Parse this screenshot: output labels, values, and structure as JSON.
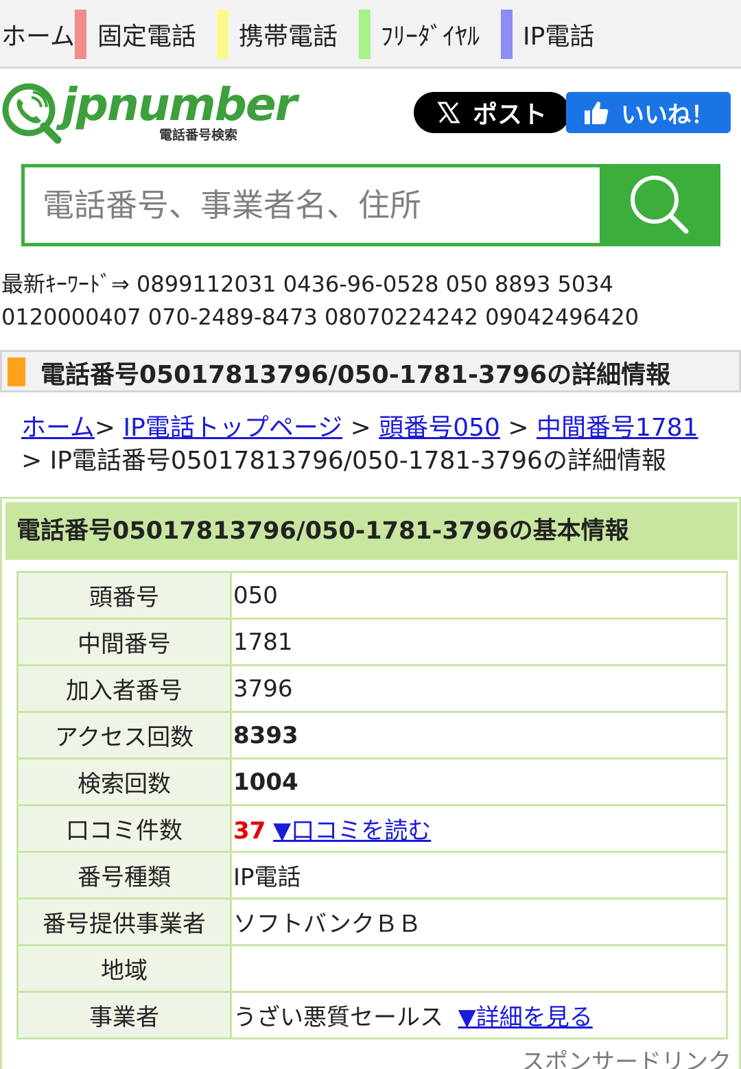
{
  "nav": {
    "items": [
      {
        "label": "ホーム"
      },
      {
        "label": "固定電話",
        "color": "#f28b8b"
      },
      {
        "label": "携帯電話",
        "color": "#fafa8c"
      },
      {
        "label": "ﾌﾘｰﾀﾞｲﾔﾙ",
        "color": "#a8f28b"
      },
      {
        "label": "IP電話",
        "color": "#8c8cf2"
      }
    ]
  },
  "logo": {
    "word": "jpnumber",
    "sub": "電話番号検索",
    "icon": "phone-magnifier-icon"
  },
  "share": {
    "post_label": "ポスト",
    "like_label": "いいね！"
  },
  "search": {
    "placeholder": "電話番号、事業者名、住所",
    "icon": "search-icon"
  },
  "keywords": {
    "label": "最新ｷｰﾜｰﾄﾞ⇒",
    "items": [
      "0899112031",
      "0436-96-0528",
      "050 8893 5034",
      "0120000407",
      "070-2489-8473",
      "08070224242",
      "09042496420"
    ]
  },
  "heading": {
    "text": "電話番号05017813796/050-1781-3796の詳細情報",
    "accent": "#ffa31a"
  },
  "breadcrumb": {
    "home": "ホーム",
    "ip_top": "IP電話トップページ",
    "prefix": "頭番号050",
    "middle": "中間番号1781",
    "current": "IP電話番号05017813796/050-1781-3796の詳細情報",
    "sep": "> "
  },
  "info": {
    "title": "電話番号05017813796/050-1781-3796の基本情報",
    "rows": [
      {
        "key": "頭番号",
        "value": "050"
      },
      {
        "key": "中間番号",
        "value": "1781"
      },
      {
        "key": "加入者番号",
        "value": "3796"
      },
      {
        "key": "アクセス回数",
        "value": "8393"
      },
      {
        "key": "検索回数",
        "value": "1004"
      },
      {
        "key": "口コミ件数",
        "value": "37",
        "link": "▼口コミを読む"
      },
      {
        "key": "番号種類",
        "value": "IP電話"
      },
      {
        "key": "番号提供事業者",
        "value": "ソフトバンクＢＢ"
      },
      {
        "key": "地域",
        "value": ""
      },
      {
        "key": "事業者",
        "value": "うざい悪質セールス",
        "link": "▼詳細を見る"
      }
    ]
  },
  "sponsor": "スポンサードリンク"
}
